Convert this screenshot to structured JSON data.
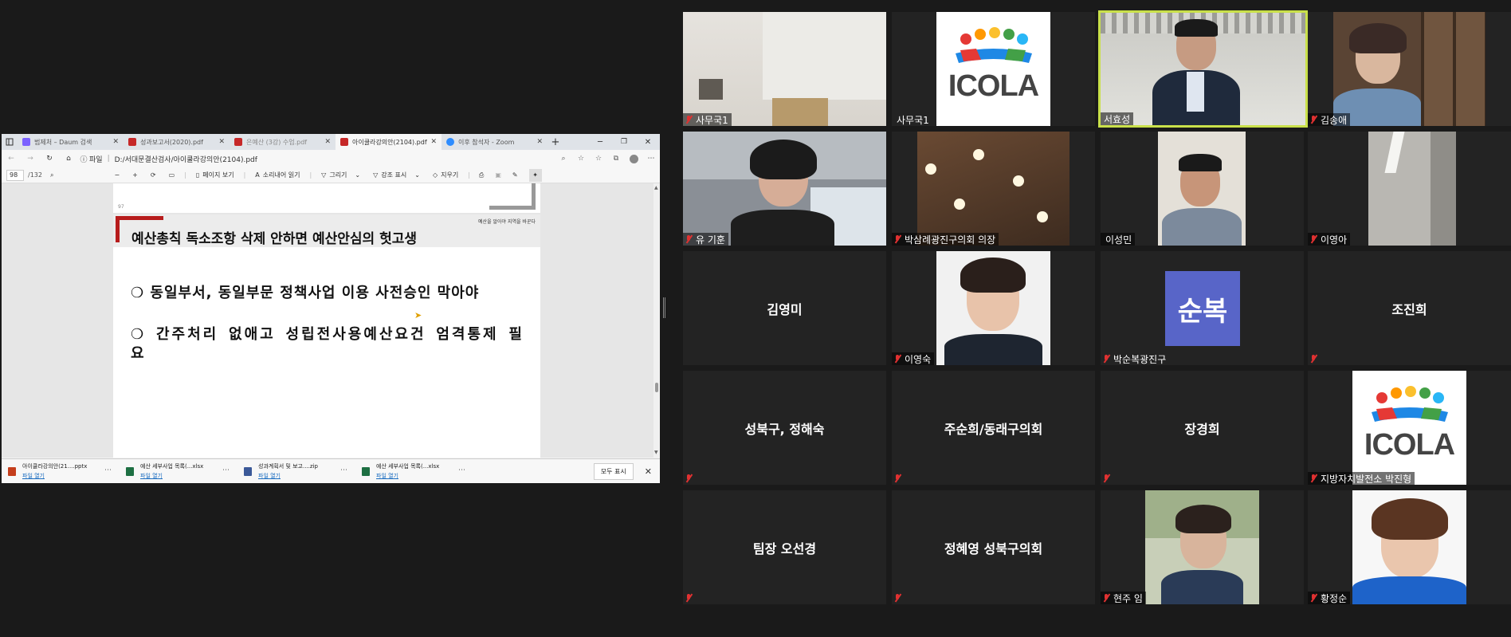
{
  "browser": {
    "tabs": [
      {
        "label": "범제처 – Daum 검색",
        "icon": "daum-icon",
        "color": "#7b61ff",
        "state": "inactive"
      },
      {
        "label": "성과보고서(2020).pdf",
        "icon": "pdf-icon",
        "color": "#c62828",
        "state": "inactive"
      },
      {
        "label": "은예산 (3강) 수업.pdf",
        "icon": "pdf-icon",
        "color": "#c62828",
        "state": "inactive"
      },
      {
        "label": "아이쿨라강의안(2104).pdf",
        "icon": "pdf-icon",
        "color": "#c62828",
        "state": "active"
      },
      {
        "label": "이후 참석자 - Zoom",
        "icon": "zoom-icon",
        "color": "#2d8cff",
        "state": "inactive"
      }
    ],
    "new_tab": "+",
    "address": {
      "scheme_label": "파일",
      "url": "D:/서대문결산검사/아이쿨라강의안(2104).pdf"
    },
    "pdf_toolbar": {
      "page_current": "98",
      "page_total": "/132",
      "page_view": "페이지 보기",
      "read_aloud": "소리내어 읽기",
      "draw": "그리기",
      "highlight": "강조 표시",
      "erase": "지우기"
    },
    "pdf_page": {
      "prev_page_number": "97",
      "header_tagline": "예산을 알아야 지역을 바꾼다",
      "slide_title": "예산총칙 독소조항 삭제 안하면 예산안심의 헛고생",
      "bullets": [
        "❍ 동일부서, 동일부문 정책사업 이용 사전승인 막아야",
        "❍ 간주처리 없애고 성립전사용예산요건 엄격통제 필요"
      ]
    },
    "downloads": [
      {
        "name": "아이쿨라강의안(21....pptx",
        "open": "파일 열기",
        "icon": "pptx-icon",
        "color": "#c43e1c"
      },
      {
        "name": "예산 세부사업 목록(...xlsx",
        "open": "파일 열기",
        "icon": "xlsx-icon",
        "color": "#1d6f42"
      },
      {
        "name": "성과계획서 및 보고....zip",
        "open": "파일 열기",
        "icon": "zip-icon",
        "color": "#3b5998"
      },
      {
        "name": "예산 세부사업 목록(...xlsx",
        "open": "파일 열기",
        "icon": "xlsx-icon",
        "color": "#1d6f42"
      }
    ],
    "show_all": "모두 표시"
  },
  "zoom": {
    "tiles": [
      {
        "name": "사무국1",
        "muted": true,
        "kind": "room"
      },
      {
        "name": "사무국1",
        "muted": false,
        "kind": "logo",
        "logo_text": "ICOLA"
      },
      {
        "name": "서효성",
        "muted": false,
        "kind": "person",
        "active_speaker": true
      },
      {
        "name": "김송애",
        "muted": true,
        "kind": "person"
      },
      {
        "name": "유 기훈",
        "muted": true,
        "kind": "person"
      },
      {
        "name": "박삼례광진구의회 의장",
        "muted": true,
        "kind": "ceiling"
      },
      {
        "name": "이성민",
        "muted": false,
        "kind": "person"
      },
      {
        "name": "이영아",
        "muted": true,
        "kind": "ceiling"
      },
      {
        "name": "김영미",
        "muted": false,
        "kind": "text"
      },
      {
        "name": "이영숙",
        "muted": true,
        "kind": "person"
      },
      {
        "name": "박순복광진구",
        "muted": true,
        "kind": "avatar",
        "avatar_text": "순복",
        "avatar_color": "#5865c8"
      },
      {
        "name": "조진희",
        "muted": true,
        "kind": "text"
      },
      {
        "name": "성북구, 정해숙",
        "muted": true,
        "kind": "text"
      },
      {
        "name": "주순희/동래구의회",
        "muted": true,
        "kind": "text"
      },
      {
        "name": "장경희",
        "muted": true,
        "kind": "text"
      },
      {
        "name": "지방자치발전소 박진형",
        "muted": true,
        "kind": "logo",
        "logo_text": "ICOLA"
      },
      {
        "name": "팀장 오선경",
        "muted": true,
        "kind": "text"
      },
      {
        "name": "정혜영 성북구의회",
        "muted": true,
        "kind": "text"
      },
      {
        "name": "현주 임",
        "muted": true,
        "kind": "person"
      },
      {
        "name": "황정순",
        "muted": true,
        "kind": "person"
      }
    ]
  },
  "colors": {
    "active_speaker_border": "#c9e04a",
    "muted_icon": "#e03131"
  }
}
